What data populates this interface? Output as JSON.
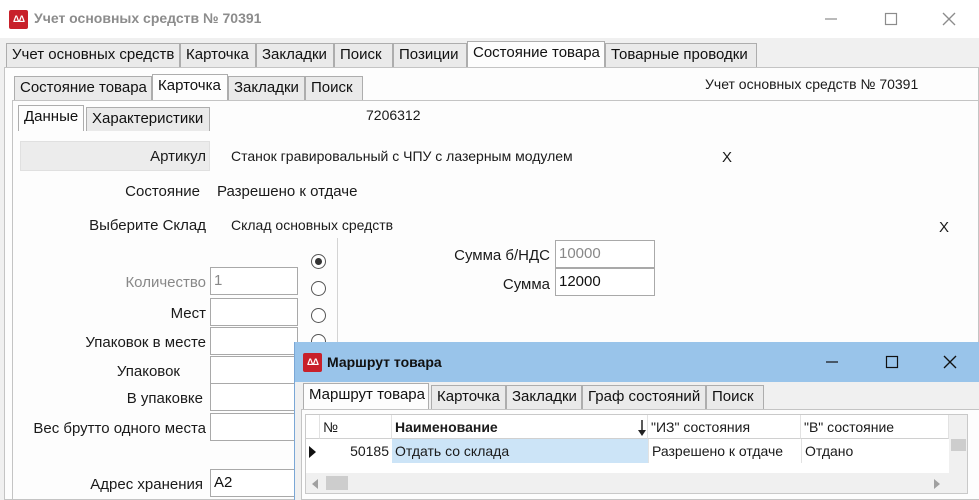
{
  "window": {
    "logo_text": "ΔΔ",
    "title": "Учет основных средств № 70391"
  },
  "top_tabs": [
    {
      "label": "Учет основных средств"
    },
    {
      "label": "Карточка"
    },
    {
      "label": "Закладки"
    },
    {
      "label": "Поиск"
    },
    {
      "label": "Позиции"
    },
    {
      "label": "Состояние товара"
    },
    {
      "label": "Товарные проводки"
    }
  ],
  "second_tabs": [
    {
      "label": "Состояние товара"
    },
    {
      "label": "Карточка"
    },
    {
      "label": "Закладки"
    },
    {
      "label": "Поиск"
    }
  ],
  "record_title": "Учет основных средств № 70391",
  "third_tabs": [
    {
      "label": "Данные"
    },
    {
      "label": "Характеристики"
    }
  ],
  "code_value": "7206312",
  "form": {
    "article_label": "Артикул",
    "article_value": "Станок гравировальный с ЧПУ с лазерным модулем",
    "article_clear": "X",
    "state_label": "Состояние",
    "state_value": "Разрешено к отдаче",
    "warehouse_label": "Выберите Склад",
    "warehouse_value": "Склад основных средств",
    "warehouse_clear": "X",
    "sum_novat_label": "Сумма  б/НДС",
    "sum_novat_value": "10000",
    "sum_label": "Сумма",
    "sum_value": "12000",
    "qty_label": "Количество",
    "qty_value": "1",
    "places_label": "Мест",
    "places_value": "",
    "packs_per_place_label": "Упаковок в месте",
    "packs_per_place_value": "",
    "packs_label": "Упаковок",
    "packs_value": "",
    "per_pack_label": "В упаковке",
    "per_pack_value": "",
    "gross_weight_label": "Вес брутто одного места",
    "gross_weight_value": "",
    "storage_address_label": "Адрес хранения",
    "storage_address_value": "А2"
  },
  "route_window": {
    "logo_text": "ΔΔ",
    "title": "Маршрут товара",
    "tabs": [
      {
        "label": "Маршрут товара"
      },
      {
        "label": "Карточка"
      },
      {
        "label": "Закладки"
      },
      {
        "label": "Граф состояний"
      },
      {
        "label": "Поиск"
      }
    ],
    "columns": {
      "num": "№",
      "name": "Наименование",
      "from_state": "\"ИЗ\" состояния",
      "to_state": "\"В\" состояние"
    },
    "rows": [
      {
        "num": "50185",
        "name": "Отдать со склада",
        "from_state": "Разрешено к отдаче",
        "to_state": "Отдано"
      }
    ]
  },
  "colors": {
    "accent_logo": "#c8202a",
    "sub_title_bg": "#99c4ea",
    "selected_cell": "#cce4f7"
  }
}
